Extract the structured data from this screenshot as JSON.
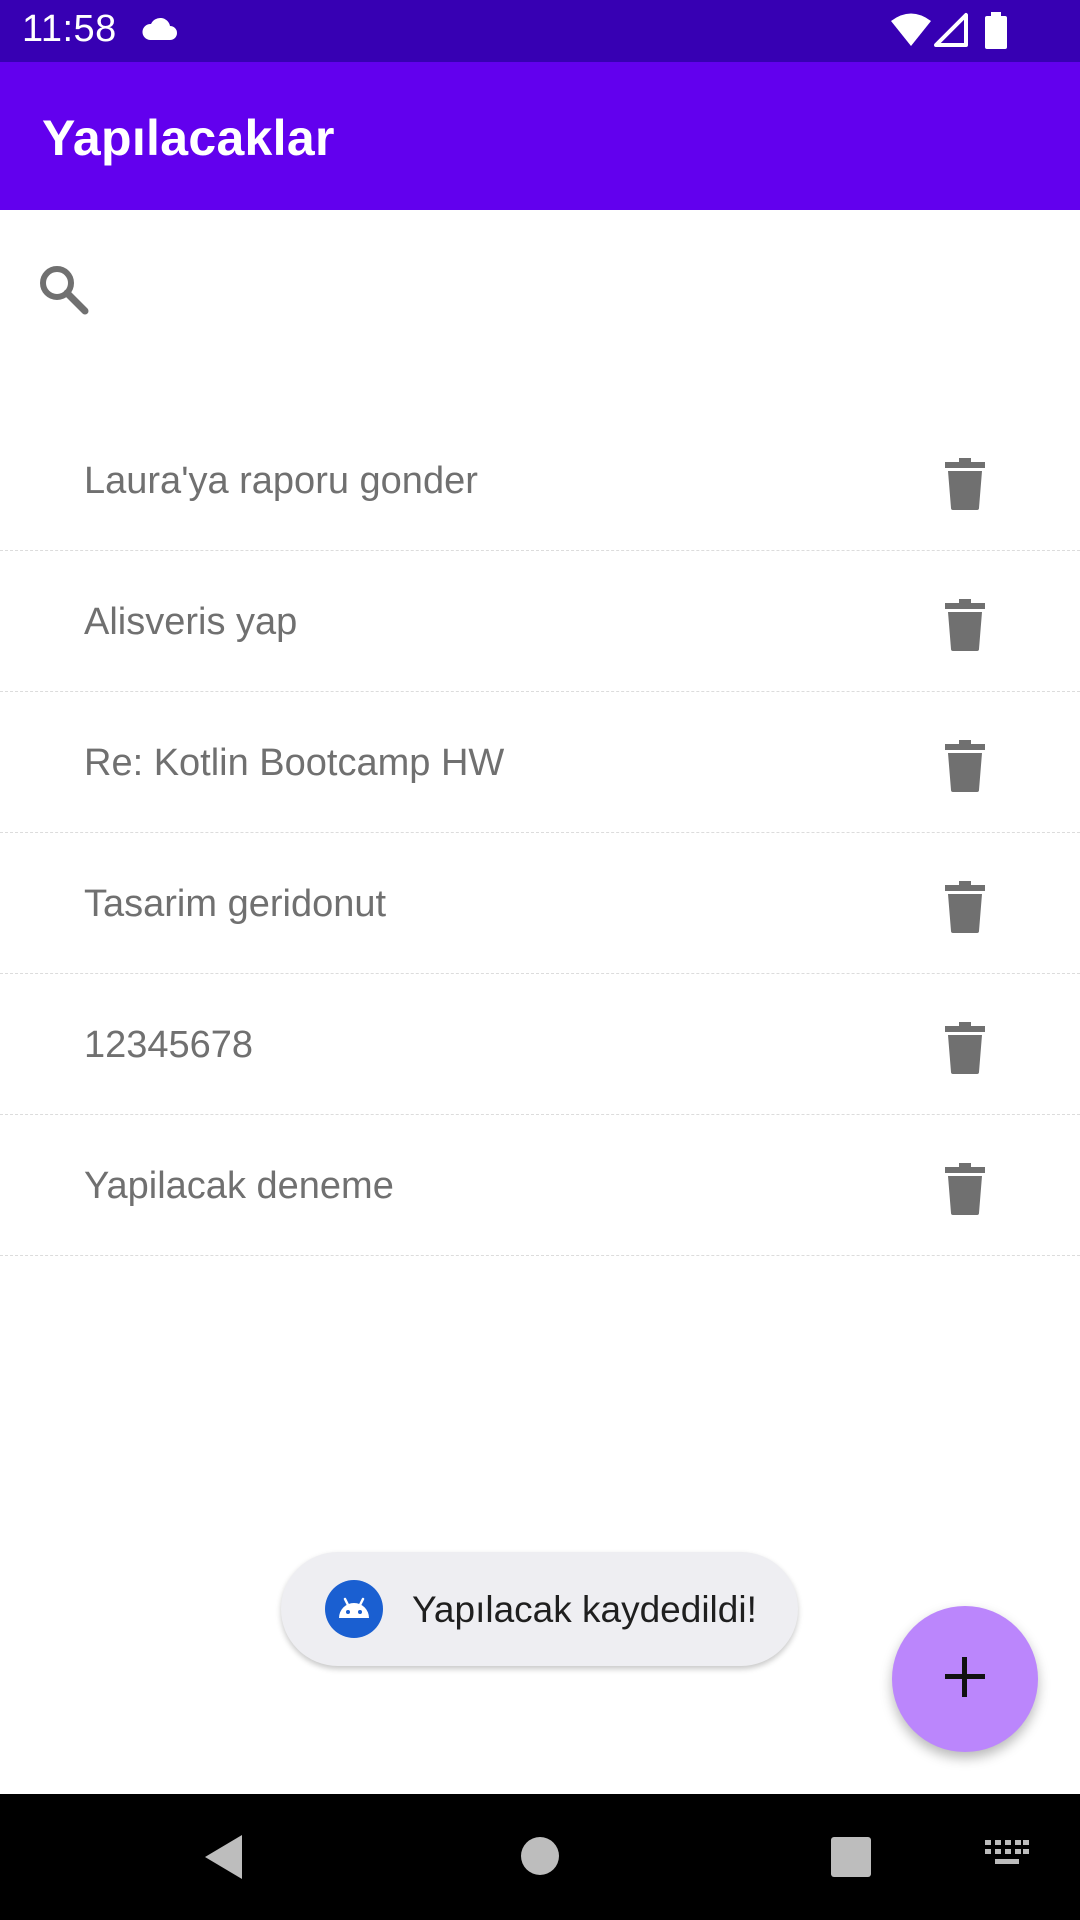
{
  "status_bar": {
    "time": "11:58",
    "icons": [
      "cloud-icon",
      "wifi-icon",
      "signal-icon",
      "battery-icon"
    ]
  },
  "app_bar": {
    "title": "Yapılacaklar"
  },
  "search": {
    "value": "",
    "placeholder": "",
    "icon": "search-icon"
  },
  "todos": [
    {
      "text": "Laura'ya raporu gonder"
    },
    {
      "text": "Alisveris yap"
    },
    {
      "text": "Re: Kotlin Bootcamp HW"
    },
    {
      "text": "Tasarim geridonut"
    },
    {
      "text": "12345678"
    },
    {
      "text": "Yapilacak deneme"
    }
  ],
  "toast": {
    "message": "Yapılacak kaydedildi!",
    "icon": "android-icon"
  },
  "fab": {
    "icon": "plus-icon"
  },
  "nav_bar": {
    "icons": [
      "back-icon",
      "home-icon",
      "recents-icon",
      "keyboard-icon"
    ]
  },
  "colors": {
    "status_bar": "#3700B3",
    "app_bar": "#6200EE",
    "fab": "#BB86FC",
    "icon_gray": "#707070",
    "toast_bg": "#EEEEF2",
    "android_badge": "#1A5FD1"
  }
}
